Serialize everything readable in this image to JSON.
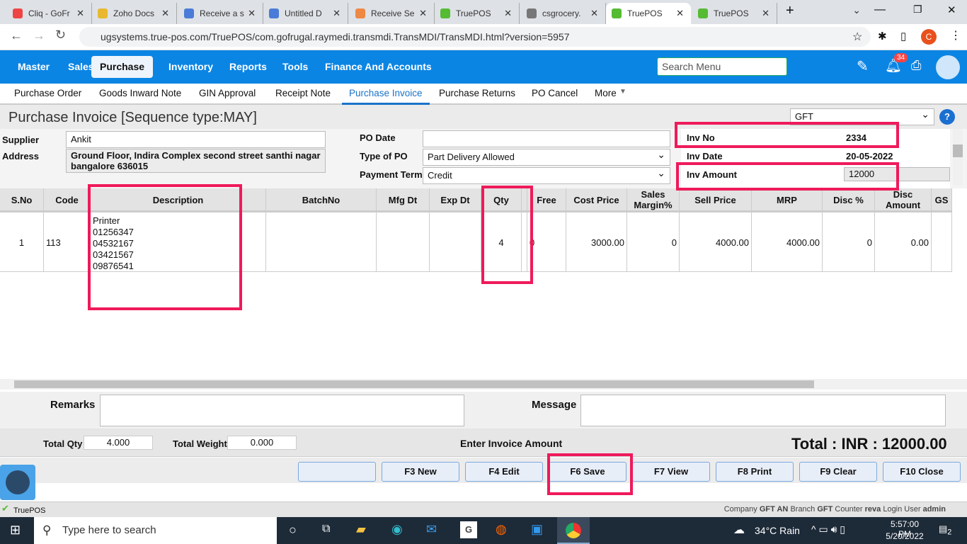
{
  "browser": {
    "tabs": [
      {
        "label": "Cliq - GoFr",
        "color": "#e44"
      },
      {
        "label": "Zoho Docs",
        "color": "#e8b830"
      },
      {
        "label": "Receive a s",
        "color": "#4a7bd8"
      },
      {
        "label": "Untitled D",
        "color": "#4a7bd8"
      },
      {
        "label": "Receive Se",
        "color": "#e84"
      },
      {
        "label": "TruePOS",
        "color": "#5b3"
      },
      {
        "label": "csgrocery.",
        "color": "#777"
      },
      {
        "label": "TruePOS",
        "color": "#5b3",
        "active": true
      },
      {
        "label": "TruePOS",
        "color": "#5b3"
      }
    ],
    "url": "ugsystems.true-pos.com/TruePOS/com.gofrugal.raymedi.transmdi.TransMDI/TransMDI.html?version=5957",
    "profile": "C"
  },
  "nav": {
    "items": [
      "Master",
      "Sales",
      "Purchase",
      "Inventory",
      "Reports",
      "Tools",
      "Finance And Accounts"
    ],
    "search_placeholder": "Search Menu",
    "notification_count": "34"
  },
  "subnav": {
    "items": [
      "Purchase Order",
      "Goods Inward Note",
      "GIN Approval",
      "Receipt Note",
      "Purchase Invoice",
      "Purchase Returns",
      "PO Cancel",
      "More"
    ]
  },
  "page": {
    "title": "Purchase Invoice [Sequence type:MAY]",
    "branch_select": "GFT"
  },
  "form": {
    "supplier_label": "Supplier",
    "supplier": "Ankit",
    "address_label": "Address",
    "address": "Ground Floor, Indira Complex second street santhi nagar bangalore 636015",
    "po_date_label": "PO Date",
    "po_date": "",
    "type_of_po_label": "Type of PO",
    "type_of_po": "Part Delivery Allowed",
    "payment_terms_label": "Payment Terms",
    "payment_terms": "Credit",
    "inv_no_label": "Inv No",
    "inv_no": "2334",
    "inv_date_label": "Inv Date",
    "inv_date": "20-05-2022",
    "inv_amount_label": "Inv Amount",
    "inv_amount": "12000"
  },
  "table": {
    "headers": [
      "S.No",
      "Code",
      "Description",
      "BatchNo",
      "Mfg Dt",
      "Exp Dt",
      "Qty",
      "",
      "Free",
      "Cost Price",
      "Sales Margin%",
      "Sell Price",
      "MRP",
      "Disc %",
      "Disc Amount",
      "GS"
    ],
    "rows": [
      {
        "sno": "1",
        "code": "113",
        "description": [
          "Printer",
          "01256347",
          "04532167",
          "03421567",
          "09876541"
        ],
        "batch": "",
        "mfg": "",
        "exp": "",
        "qty": "4",
        "free": "0",
        "cost": "3000.00",
        "margin": "0",
        "sell": "4000.00",
        "mrp": "4000.00",
        "disc_pct": "0",
        "disc_amt": "0.00"
      }
    ]
  },
  "footer": {
    "remarks_label": "Remarks",
    "message_label": "Message",
    "total_qty_label": "Total Qty",
    "total_qty": "4.000",
    "total_weight_label": "Total Weight",
    "total_weight": "0.000",
    "hint": "Enter Invoice Amount",
    "total": "Total : INR : 12000.00"
  },
  "buttons": [
    "",
    "F3 New",
    "F4 Edit",
    "F6 Save",
    "F7 View",
    "F8 Print",
    "F9 Clear",
    "F10 Close"
  ],
  "status": {
    "app": "TruePOS",
    "company_label": "Company",
    "company": "GFT AN",
    "branch_label": "Branch",
    "branch": "GFT",
    "counter_label": "Counter",
    "counter": "reva",
    "user_label": "Login User",
    "user": "admin"
  },
  "taskbar": {
    "search_placeholder": "Type here to search",
    "weather": "34°C  Rain",
    "time": "5:57:00 PM",
    "date": "5/20/2022",
    "notifications": "2"
  }
}
